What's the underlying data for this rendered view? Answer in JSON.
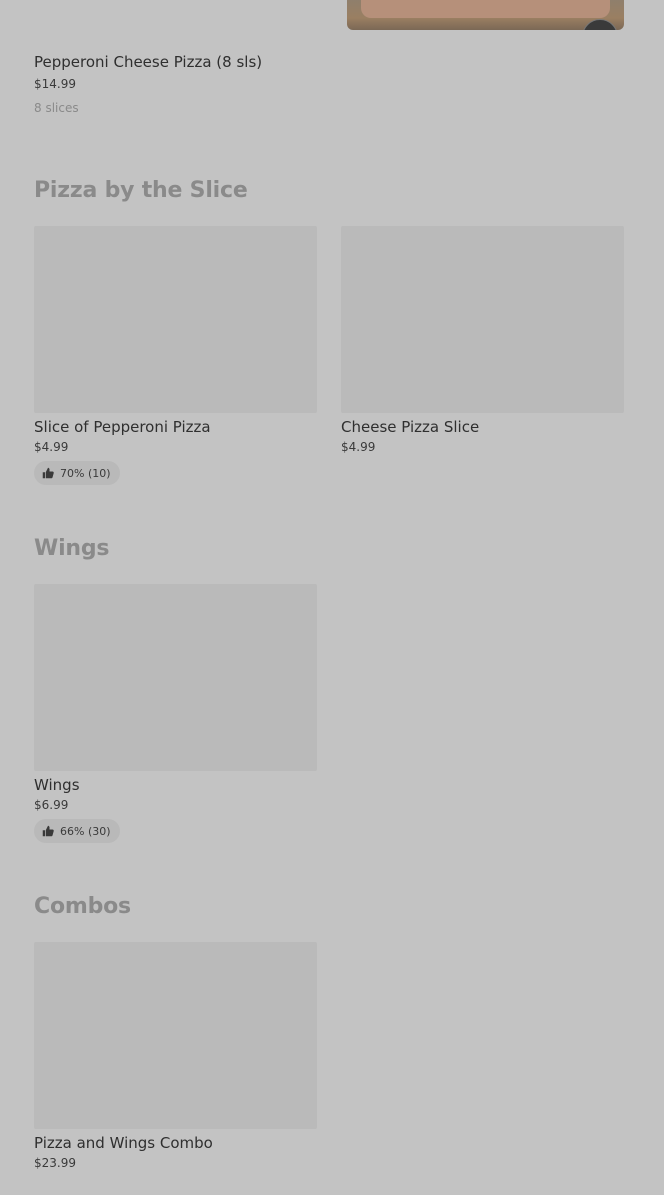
{
  "top_item": {
    "name": "Pepperoni Cheese Pizza (8 sls)",
    "price": "$14.99",
    "description": "8 slices"
  },
  "sections": [
    {
      "title": "Pizza by the Slice",
      "items": [
        {
          "name": "Slice of Pepperoni Pizza",
          "price": "$4.99",
          "rating": "70% (10)"
        },
        {
          "name": "Cheese Pizza Slice",
          "price": "$4.99"
        }
      ]
    },
    {
      "title": "Wings",
      "items": [
        {
          "name": "Wings",
          "price": "$6.99",
          "rating": "66% (30)"
        }
      ]
    },
    {
      "title": "Combos",
      "items": [
        {
          "name": "Pizza and Wings Combo",
          "price": "$23.99"
        }
      ]
    }
  ],
  "icons": {
    "rating": "thumbs-up-icon",
    "add": "add-to-cart-icon"
  }
}
